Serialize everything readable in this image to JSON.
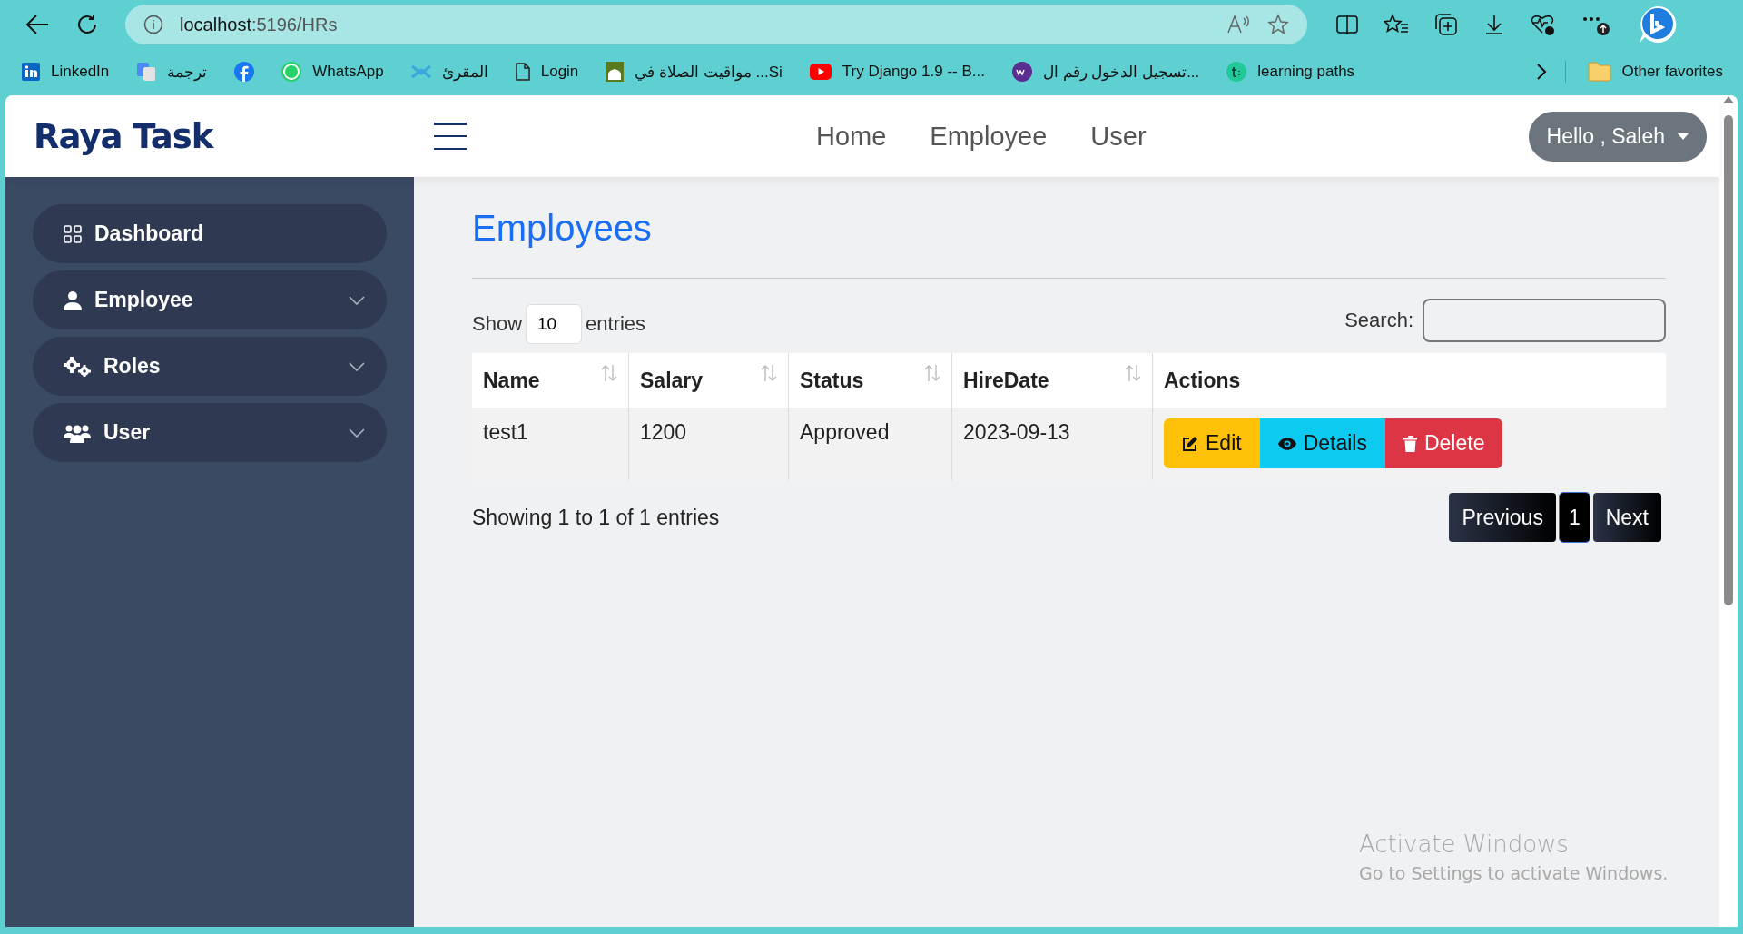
{
  "browser": {
    "address": {
      "host": "localhost",
      "path": ":5196/HRs"
    },
    "bookmarks": [
      {
        "kind": "linkedin",
        "label": "LinkedIn"
      },
      {
        "kind": "translate",
        "label": "ترجمة"
      },
      {
        "kind": "facebook"
      },
      {
        "kind": "whatsapp",
        "label": "WhatsApp"
      },
      {
        "kind": "quran",
        "label": "المقرئ"
      },
      {
        "kind": "page",
        "label": "Login"
      },
      {
        "kind": "mosque",
        "label": "مواقيت الصلاة في ...Si"
      },
      {
        "kind": "youtube",
        "label": "Try Django 1.9 -- B..."
      },
      {
        "kind": "we",
        "label": "تسجيل الدخول رقم ال..."
      },
      {
        "kind": "letter",
        "label": "learning paths"
      }
    ],
    "other_favorites": "Other favorites"
  },
  "header": {
    "brand": "Raya Task",
    "nav": [
      "Home",
      "Employee",
      "User"
    ],
    "user_menu": "Hello , Saleh"
  },
  "sidebar": {
    "items": [
      {
        "kind": "grid",
        "label": "Dashboard",
        "has_submenu": false
      },
      {
        "kind": "person",
        "label": "Employee",
        "has_submenu": true
      },
      {
        "kind": "gears",
        "label": "Roles",
        "has_submenu": true
      },
      {
        "kind": "people",
        "label": "User",
        "has_submenu": true
      }
    ]
  },
  "main": {
    "title": "Employees",
    "length": {
      "before": "Show",
      "value": "10",
      "after": "entries"
    },
    "search": {
      "label": "Search:"
    },
    "table": {
      "columns": [
        {
          "label": "Name",
          "sortable": true
        },
        {
          "label": "Salary",
          "sortable": true
        },
        {
          "label": "Status",
          "sortable": true
        },
        {
          "label": "HireDate",
          "sortable": true
        },
        {
          "label": "Actions",
          "sortable": false
        }
      ],
      "rows": [
        {
          "cells": [
            "test1",
            "1200",
            "Approved",
            "2023-09-13"
          ],
          "actions": [
            {
              "kind": "edit",
              "label": "Edit"
            },
            {
              "kind": "details",
              "label": "Details"
            },
            {
              "kind": "delete",
              "label": "Delete"
            }
          ]
        }
      ]
    },
    "info": "Showing 1 to 1 of 1 entries",
    "pagination": [
      {
        "label": "Previous",
        "selected": false
      },
      {
        "label": "1",
        "selected": true
      },
      {
        "label": "Next",
        "selected": false
      }
    ]
  },
  "os_overlay": {
    "title": "Activate Windows",
    "subtitle": "Go to Settings to activate Windows."
  }
}
